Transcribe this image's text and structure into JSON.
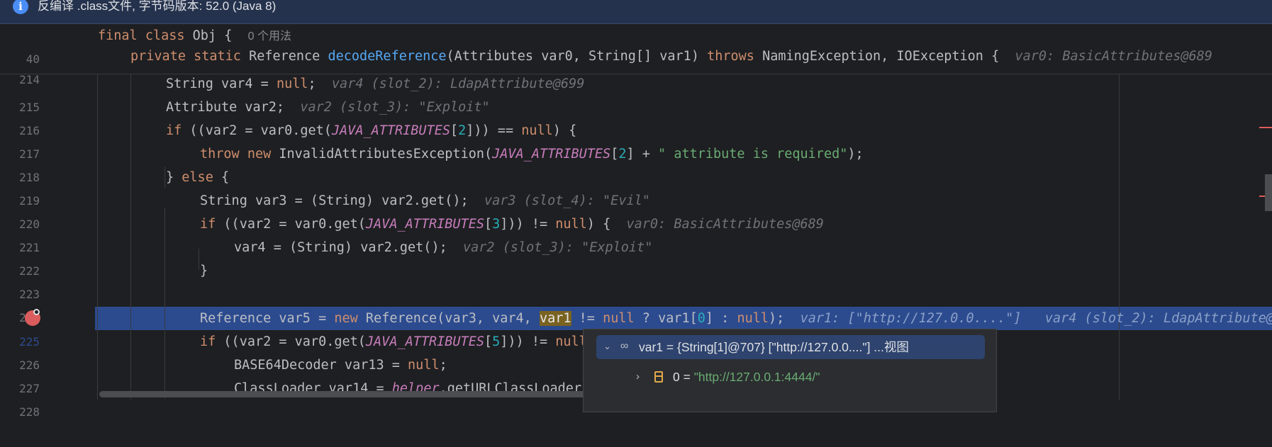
{
  "banner": {
    "icon": "info-icon",
    "message": "反编译 .class文件, 字节码版本: 52.0 (Java 8)"
  },
  "sticky": [
    {
      "num": "40",
      "pre": "final class ",
      "name": "Obj",
      "post": " {  ",
      "usage": "0 个用法"
    },
    {
      "num": "214"
    }
  ],
  "lines": [
    {
      "num": "215"
    },
    {
      "num": "216"
    },
    {
      "num": "217"
    },
    {
      "num": "218"
    },
    {
      "num": "219"
    },
    {
      "num": "220"
    },
    {
      "num": "221"
    },
    {
      "num": "222"
    },
    {
      "num": "223"
    },
    {
      "num": "224"
    },
    {
      "num": "225"
    },
    {
      "num": "226"
    },
    {
      "num": "227"
    },
    {
      "num": "228"
    }
  ],
  "popup": {
    "row1": "var1 = {String[1]@707} [\"http://127.0.0....\"] ...视图",
    "row2_key": "0 = ",
    "row2_val": "\"http://127.0.0.1:4444/\""
  },
  "colors": {
    "keyword": "#cf8e6d",
    "function": "#56a8f5",
    "constant": "#c77dbb",
    "string": "#6aab73",
    "highlight": "#2c4b8f",
    "breakpoint": "#db5c5c"
  }
}
